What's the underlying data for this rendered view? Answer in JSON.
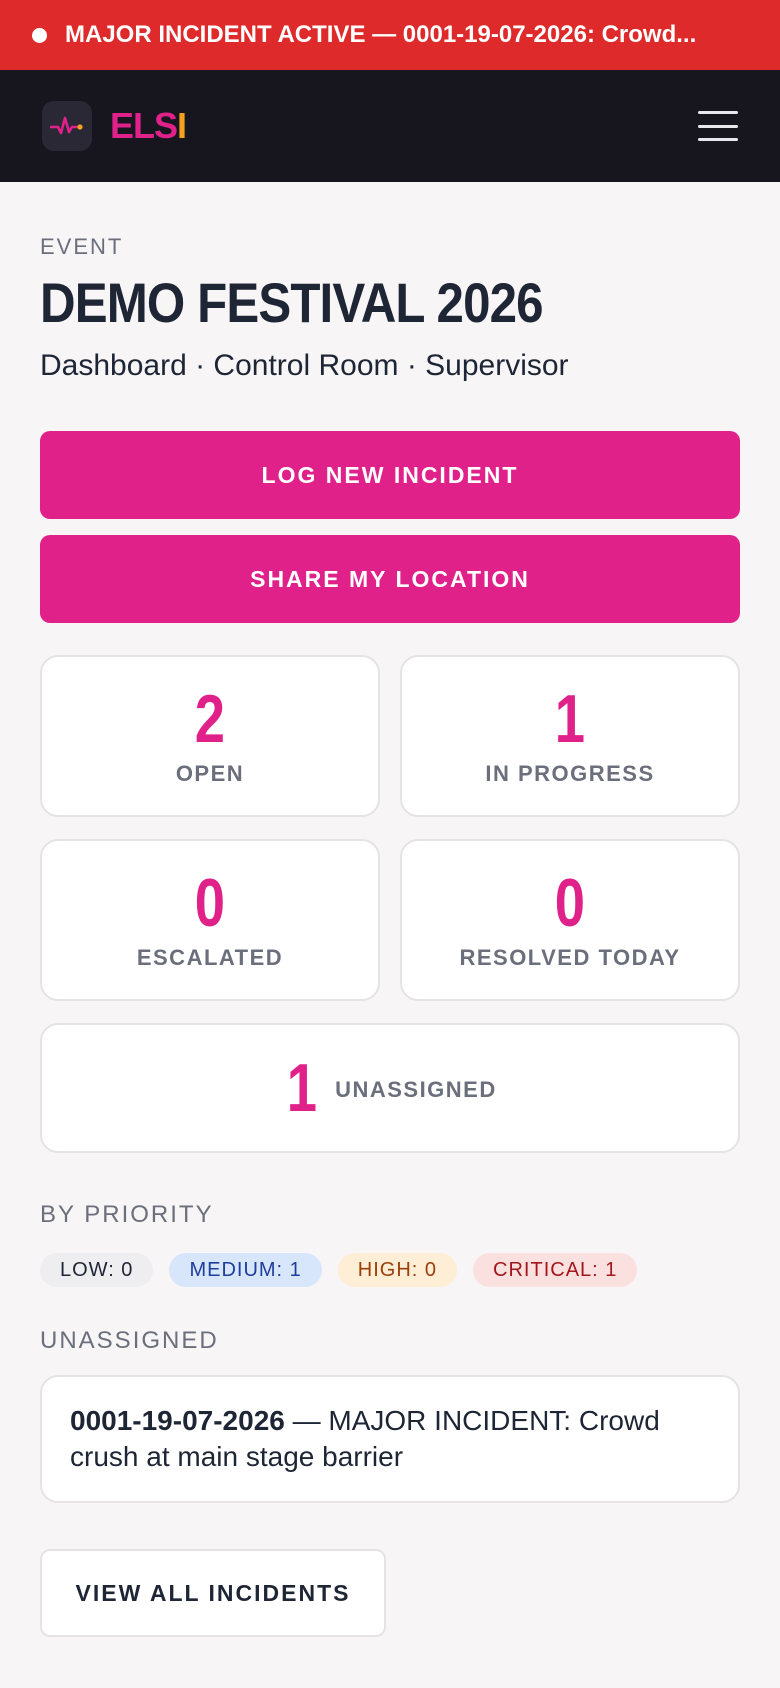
{
  "banner": {
    "text": "MAJOR INCIDENT ACTIVE — 0001-19-07-2026: Crowd..."
  },
  "header": {
    "brand_part1": "ELS",
    "brand_part2": "I",
    "logo_icon": "pulse-icon",
    "menu_icon": "hamburger-menu-icon"
  },
  "event": {
    "eyebrow": "EVENT",
    "title": "DEMO FESTIVAL 2026",
    "subtitle": "Dashboard · Control Room · Supervisor"
  },
  "actions": {
    "log_incident": "LOG NEW INCIDENT",
    "share_location": "SHARE MY LOCATION"
  },
  "stats": [
    {
      "value": "2",
      "label": "OPEN"
    },
    {
      "value": "1",
      "label": "IN PROGRESS"
    },
    {
      "value": "0",
      "label": "ESCALATED"
    },
    {
      "value": "0",
      "label": "RESOLVED TODAY"
    },
    {
      "value": "1",
      "label": "UNASSIGNED"
    }
  ],
  "priority": {
    "label": "BY PRIORITY",
    "pills": [
      {
        "text": "LOW: 0"
      },
      {
        "text": "MEDIUM: 1"
      },
      {
        "text": "HIGH: 0"
      },
      {
        "text": "CRITICAL: 1"
      }
    ]
  },
  "unassigned": {
    "label": "UNASSIGNED",
    "items": [
      {
        "ref": "0001-19-07-2026",
        "desc": " — MAJOR INCIDENT: Crowd crush at main stage barrier"
      }
    ]
  },
  "footer": {
    "view_all": "VIEW ALL INCIDENTS"
  },
  "colors": {
    "banner": "#de2a2a",
    "accent": "#e0218a",
    "brand_secondary": "#f4a21d",
    "header_bg": "#17161e"
  }
}
